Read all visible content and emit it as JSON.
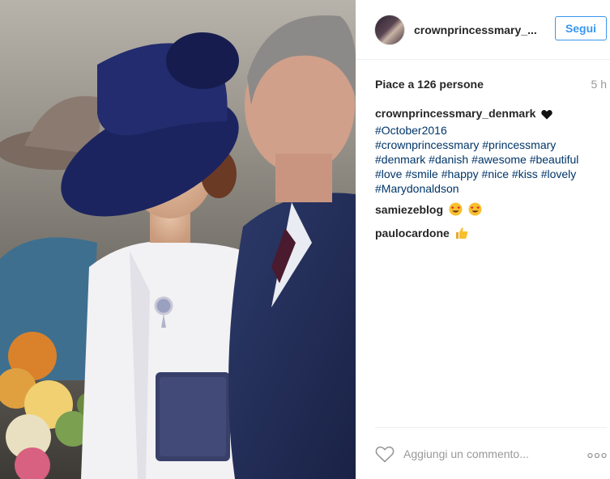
{
  "post": {
    "username_short": "crownprincessmary_...",
    "follow_label": "Segui",
    "likes_text": "Piace a 126 persone",
    "time_ago": "5 h",
    "caption_user": "crownprincessmary_denmark",
    "caption_emoji": "black-heart",
    "hashtags": [
      "#October2016",
      "#crownprincessmary",
      "#princessmary",
      "#denmark",
      "#danish",
      "#awesome",
      "#beautiful",
      "#love",
      "#smile",
      "#happy",
      "#nice",
      "#kiss",
      "#lovely",
      "#Marydonaldson"
    ],
    "comments": [
      {
        "user": "samiezeblog",
        "emoji": [
          "heart-eyes",
          "heart-eyes"
        ]
      },
      {
        "user": "paulocardone",
        "emoji": [
          "thumbs-up"
        ]
      }
    ],
    "comment_placeholder": "Aggiungi un commento...",
    "icons": {
      "like": "heart-outline-icon",
      "more": "more-options-icon"
    },
    "colors": {
      "link": "#003569",
      "follow": "#3897f0",
      "muted": "#999999"
    }
  }
}
